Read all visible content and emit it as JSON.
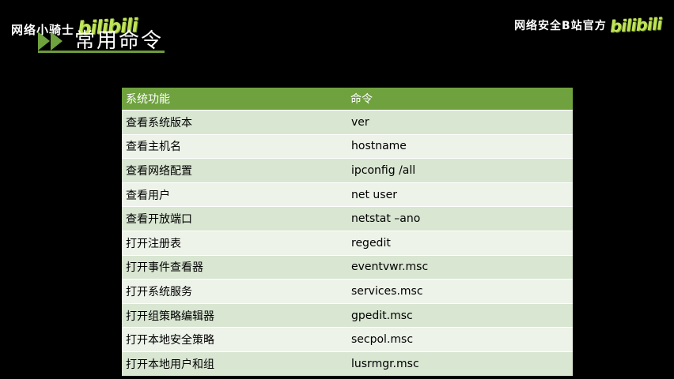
{
  "watermarks": {
    "left_text": "网络小骑士",
    "left_logo": "bilibili",
    "right_text": "网络安全B站官方",
    "right_logo": "bilibili"
  },
  "title": "常用命令",
  "colors": {
    "accent": "#6fa23f",
    "row_odd": "#d9e6d2",
    "row_even": "#edf3e9",
    "logo": "#bfe35a",
    "background": "#000000"
  },
  "table": {
    "headers": [
      "系统功能",
      "命令"
    ],
    "rows": [
      {
        "function": "查看系统版本",
        "command": "ver"
      },
      {
        "function": "查看主机名",
        "command": "hostname"
      },
      {
        "function": "查看网络配置",
        "command": "ipconfig /all"
      },
      {
        "function": "查看用户",
        "command": "net user"
      },
      {
        "function": "查看开放端口",
        "command": "netstat –ano"
      },
      {
        "function": "打开注册表",
        "command": "regedit"
      },
      {
        "function": "打开事件查看器",
        "command": "eventvwr.msc"
      },
      {
        "function": "打开系统服务",
        "command": "services.msc"
      },
      {
        "function": "打开组策略编辑器",
        "command": "gpedit.msc"
      },
      {
        "function": "打开本地安全策略",
        "command": "secpol.msc"
      },
      {
        "function": "打开本地用户和组",
        "command": "lusrmgr.msc"
      }
    ]
  },
  "icons": {
    "title_icon": "double-play-arrow-icon"
  }
}
